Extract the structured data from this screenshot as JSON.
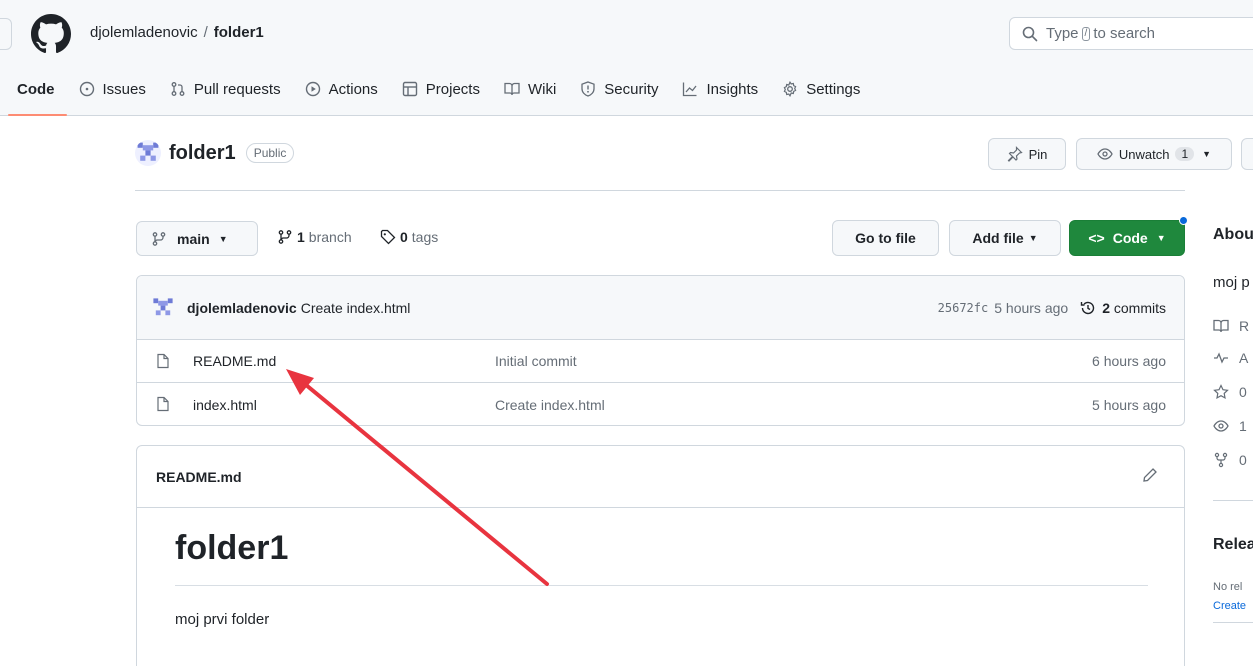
{
  "header": {
    "owner": "djolemladenovic",
    "separator": "/",
    "repo": "folder1",
    "search_prefix": "Type",
    "search_key": "/",
    "search_suffix": "to search"
  },
  "nav": {
    "tabs": [
      {
        "label": "Code",
        "icon": "code-icon"
      },
      {
        "label": "Issues",
        "icon": "issue-icon"
      },
      {
        "label": "Pull requests",
        "icon": "pull-request-icon"
      },
      {
        "label": "Actions",
        "icon": "play-icon"
      },
      {
        "label": "Projects",
        "icon": "table-icon"
      },
      {
        "label": "Wiki",
        "icon": "book-icon"
      },
      {
        "label": "Security",
        "icon": "shield-icon"
      },
      {
        "label": "Insights",
        "icon": "graph-icon"
      },
      {
        "label": "Settings",
        "icon": "gear-icon"
      }
    ]
  },
  "repo": {
    "name": "folder1",
    "visibility": "Public",
    "pin_label": "Pin",
    "watch_label": "Unwatch",
    "watch_count": "1"
  },
  "branch": {
    "current": "main",
    "branch_count": "1",
    "branch_label": "branch",
    "tag_count": "0",
    "tag_label": "tags",
    "go_to_file": "Go to file",
    "add_file": "Add file",
    "code_label": "Code"
  },
  "latest_commit": {
    "author": "djolemladenovic",
    "message": "Create index.html",
    "sha": "25672fc",
    "age": "5 hours ago",
    "commit_count": "2",
    "commit_label": "commits"
  },
  "files": [
    {
      "name": "README.md",
      "message": "Initial commit",
      "age": "6 hours ago"
    },
    {
      "name": "index.html",
      "message": "Create index.html",
      "age": "5 hours ago"
    }
  ],
  "readme": {
    "filename": "README.md",
    "heading": "folder1",
    "body": "moj prvi folder"
  },
  "sidebar": {
    "about_heading": "Abou",
    "description": "moj p",
    "items": [
      "R",
      "A",
      "0",
      "1",
      "0"
    ],
    "releases_heading": "Relea",
    "releases_note": "No rel",
    "releases_link": "Create"
  },
  "colors": {
    "accent_green": "#1f883d",
    "active_tab_underline": "#fd8c73",
    "annotation_arrow": "#e8343f"
  }
}
